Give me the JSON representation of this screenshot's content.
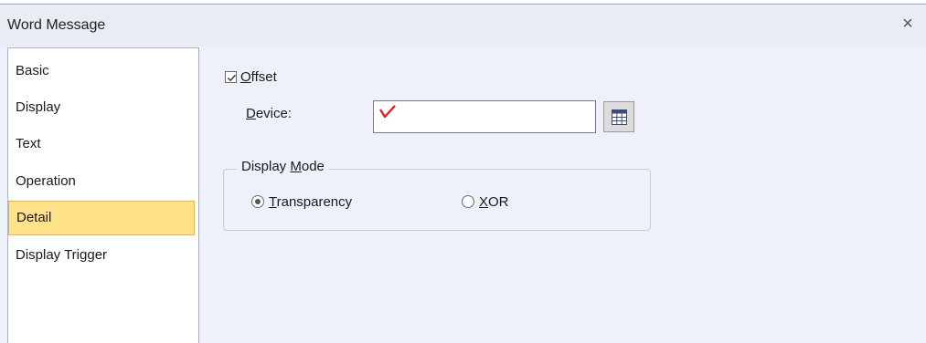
{
  "dialog": {
    "title": "Word Message",
    "close_symbol": "×"
  },
  "sidebar": {
    "items": [
      {
        "label": "Basic",
        "selected": false
      },
      {
        "label": "Display",
        "selected": false
      },
      {
        "label": "Text",
        "selected": false
      },
      {
        "label": "Operation",
        "selected": false
      },
      {
        "label": "Detail",
        "selected": true
      },
      {
        "label": "Display Trigger",
        "selected": false
      }
    ]
  },
  "detail": {
    "offset": {
      "label_mnemonic": "O",
      "label_rest": "ffset",
      "checked": true
    },
    "device": {
      "label_mnemonic": "D",
      "label_rest": "evice:",
      "value": "",
      "validation_mark_color": "#e02020"
    },
    "display_mode": {
      "title_prefix": "Display ",
      "title_mnemonic": "M",
      "title_rest": "ode",
      "options": [
        {
          "mnemonic": "T",
          "rest": "ransparency",
          "selected": true
        },
        {
          "mnemonic": "X",
          "rest": "OR",
          "selected": false
        }
      ]
    }
  },
  "colors": {
    "selected_bg": "#ffe28a",
    "selected_border": "#e8b34a",
    "dialog_bg": "#eef1f9"
  }
}
